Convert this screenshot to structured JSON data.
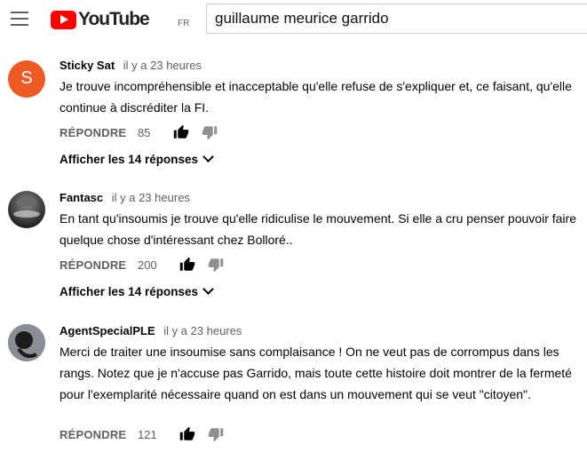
{
  "header": {
    "logo_text": "YouTube",
    "country_code": "FR",
    "search_value": "guillaume meurice garrido"
  },
  "comments": [
    {
      "author": "Sticky Sat",
      "time": "il y a 23 heures",
      "avatar_letter": "S",
      "avatar_color": "#ee5a24",
      "text": "Je trouve incompréhensible et inacceptable qu'elle refuse de s'expliquer et, ce faisant, qu'elle continue à discréditer la FI.",
      "reply_label": "RÉPONDRE",
      "likes": "85",
      "replies_label": "Afficher les 14 réponses"
    },
    {
      "author": "Fantasc",
      "time": "il y a 23 heures",
      "text": "En tant qu'insoumis je trouve qu'elle ridiculise le mouvement. Si elle a cru penser pouvoir faire quelque chose d'intéressant chez Bolloré..",
      "reply_label": "RÉPONDRE",
      "likes": "200",
      "replies_label": "Afficher les 14 réponses"
    },
    {
      "author": "AgentSpecialPLE",
      "time": "il y a 23 heures",
      "text": "Merci de traiter une insoumise sans complaisance ! On ne veut pas de corrompus dans les rangs. Notez que je n'accuse pas Garrido, mais toute cette histoire doit montrer de la fermeté pour l'exemplarité nécessaire quand on est dans un mouvement qui se veut \"citoyen\".",
      "reply_label": "RÉPONDRE",
      "likes": "121"
    }
  ]
}
